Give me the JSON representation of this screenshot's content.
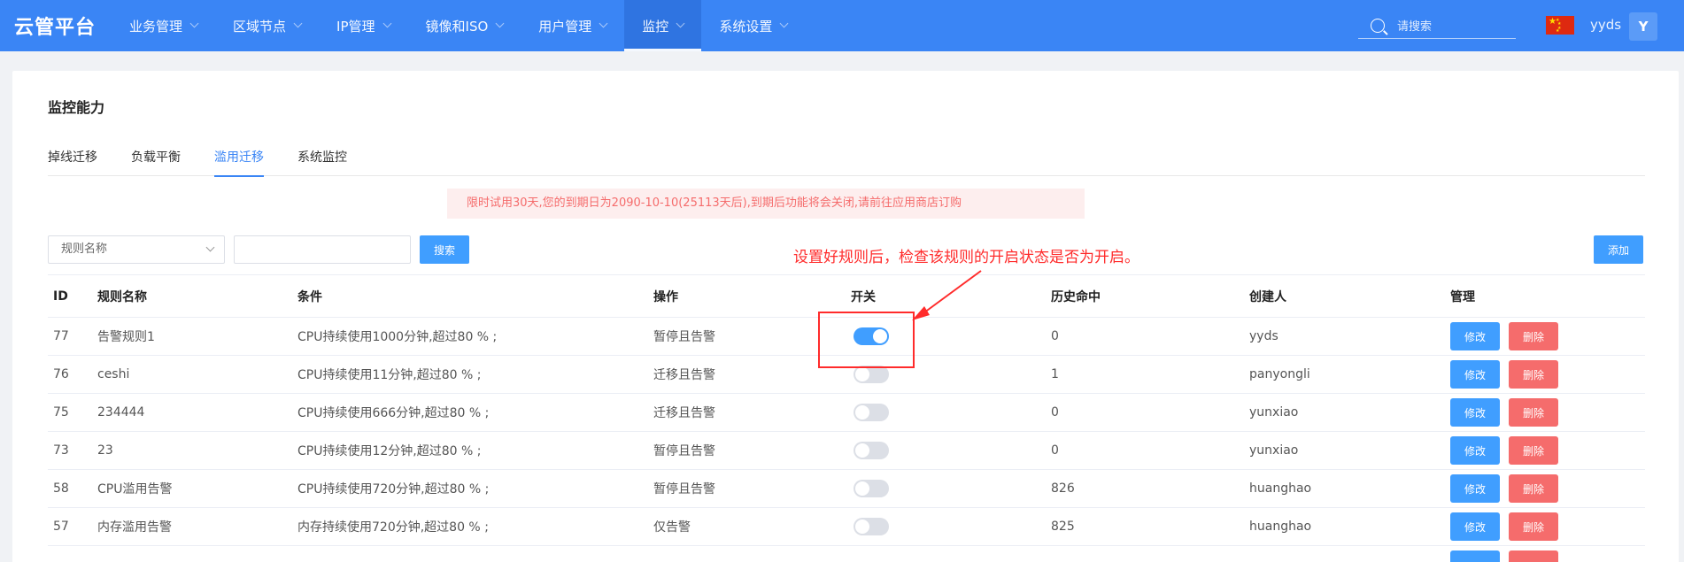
{
  "header": {
    "logo": "云管平台",
    "nav": [
      {
        "label": "业务管理",
        "active": false
      },
      {
        "label": "区域节点",
        "active": false
      },
      {
        "label": "IP管理",
        "active": false
      },
      {
        "label": "镜像和ISO",
        "active": false
      },
      {
        "label": "用户管理",
        "active": false
      },
      {
        "label": "监控",
        "active": true
      },
      {
        "label": "系统设置",
        "active": false
      }
    ],
    "search_placeholder": "请搜索",
    "username": "yyds",
    "avatar_letter": "Y"
  },
  "page": {
    "title": "监控能力",
    "tabs": [
      {
        "label": "掉线迁移",
        "active": false
      },
      {
        "label": "负载平衡",
        "active": false
      },
      {
        "label": "滥用迁移",
        "active": true
      },
      {
        "label": "系统监控",
        "active": false
      }
    ],
    "notice": "限时试用30天,您的到期日为2090-10-10(25113天后),到期后功能将会关闭,请前往应用商店订购",
    "filter_select": "规则名称",
    "search_button": "搜索",
    "add_button": "添加",
    "annotation": "设置好规则后，检查该规则的开启状态是否为开启。"
  },
  "table": {
    "columns": [
      "ID",
      "规则名称",
      "条件",
      "操作",
      "开关",
      "历史命中",
      "创建人",
      "管理"
    ],
    "rows": [
      {
        "id": "77",
        "name": "告警规则1",
        "condition": "CPU持续使用1000分钟,超过80 % ;",
        "action": "暂停且告警",
        "enabled": true,
        "hits": "0",
        "creator": "yyds"
      },
      {
        "id": "76",
        "name": "ceshi",
        "condition": "CPU持续使用11分钟,超过80 % ;",
        "action": "迁移且告警",
        "enabled": false,
        "hits": "1",
        "creator": "panyongli"
      },
      {
        "id": "75",
        "name": "234444",
        "condition": "CPU持续使用666分钟,超过80 % ;",
        "action": "迁移且告警",
        "enabled": false,
        "hits": "0",
        "creator": "yunxiao"
      },
      {
        "id": "73",
        "name": "23",
        "condition": "CPU持续使用12分钟,超过80 % ;",
        "action": "暂停且告警",
        "enabled": false,
        "hits": "0",
        "creator": "yunxiao"
      },
      {
        "id": "58",
        "name": "CPU滥用告警",
        "condition": "CPU持续使用720分钟,超过80 % ;",
        "action": "暂停且告警",
        "enabled": false,
        "hits": "826",
        "creator": "huanghao"
      },
      {
        "id": "57",
        "name": "内存滥用告警",
        "condition": "内存持续使用720分钟,超过80 % ;",
        "action": "仅告警",
        "enabled": false,
        "hits": "825",
        "creator": "huanghao"
      }
    ],
    "edit_label": "修改",
    "delete_label": "删除"
  },
  "colors": {
    "topbar": "#3a85f5",
    "primary": "#409eff",
    "danger": "#f56c6c",
    "annotation": "#ff2b2b"
  }
}
